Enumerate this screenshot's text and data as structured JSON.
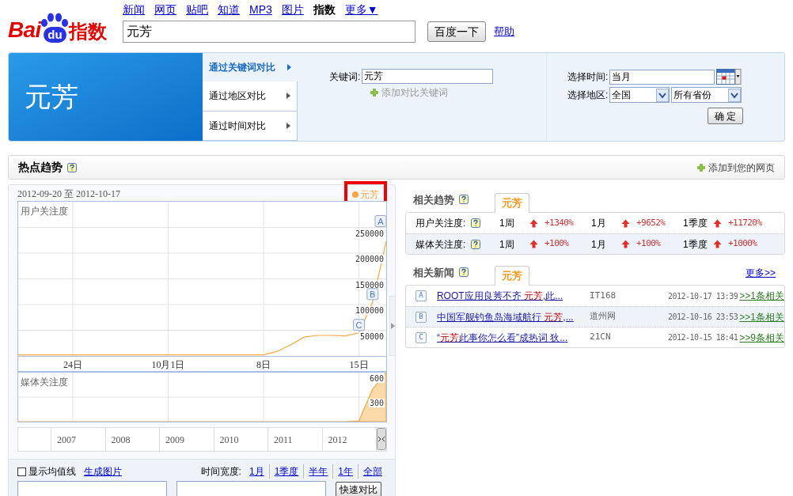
{
  "header": {
    "logo": {
      "text": "Bai",
      "badge": "du",
      "suffix": "指数"
    },
    "nav": [
      {
        "label": "新闻",
        "selected": false
      },
      {
        "label": "网页",
        "selected": false
      },
      {
        "label": "贴吧",
        "selected": false
      },
      {
        "label": "知道",
        "selected": false
      },
      {
        "label": "MP3",
        "selected": false
      },
      {
        "label": "图片",
        "selected": false
      },
      {
        "label": "指数",
        "selected": true
      },
      {
        "label": "更多▼",
        "selected": false
      }
    ],
    "search": {
      "value": "元芳"
    },
    "search_button": "百度一下",
    "help_link": "帮助"
  },
  "keyword_panel": {
    "title": "元芳",
    "compare_tabs": [
      {
        "label": "通过关键词对比",
        "selected": true
      },
      {
        "label": "通过地区对比",
        "selected": false
      },
      {
        "label": "通过时间对比",
        "selected": false
      }
    ],
    "keyword_label": "关键词:",
    "keyword": {
      "value": "元芳"
    },
    "add_keyword": "添加对比关键词",
    "time_label": "选择时间:",
    "time": {
      "value": "当月"
    },
    "region_label": "选择地区:",
    "region": {
      "value": "全国"
    },
    "province": {
      "value": "所有省份"
    },
    "confirm_button": "确 定"
  },
  "hot_trends": {
    "title": "热点趋势",
    "add_to_page": "添加到您的网页",
    "date_range": "2012-09-20 至 2012-10-17",
    "user_chart": {
      "label": "用户关注度",
      "chart_data": {
        "type": "line",
        "categories": [
          null,
          null,
          null,
          null,
          "24日",
          null,
          null,
          null,
          null,
          null,
          null,
          "10月1日",
          null,
          null,
          null,
          null,
          null,
          null,
          "8日",
          null,
          null,
          null,
          null,
          null,
          null,
          "15日",
          null,
          null
        ],
        "series": [
          {
            "name": "元芳",
            "color": "#f5a742",
            "values": [
              2000,
              2000,
              2000,
              2000,
              2000,
              2000,
              2000,
              2000,
              2000,
              2000,
              2000,
              2000,
              2000,
              2000,
              2000,
              2000,
              2000,
              2000,
              2000,
              9000,
              22000,
              37000,
              40000,
              40000,
              39000,
              45000,
              105000,
              223000
            ]
          }
        ],
        "ylim": [
          0,
          300000
        ],
        "grid": true,
        "yticks": [
          {
            "value": 50000,
            "label": "50000"
          },
          {
            "value": 100000,
            "label": "100000"
          },
          {
            "value": 150000,
            "label": "150000"
          },
          {
            "value": 200000,
            "label": "200000"
          },
          {
            "value": 250000,
            "label": "250000"
          }
        ],
        "annotations": [
          "A",
          "B",
          "C"
        ]
      }
    },
    "media_chart": {
      "label": "媒体关注度",
      "chart_data": {
        "type": "area",
        "series": [
          {
            "color": "#f5a742",
            "values": [
              0,
              0,
              0,
              0,
              0,
              0,
              0,
              0,
              0,
              0,
              0,
              0,
              0,
              0,
              0,
              0,
              0,
              0,
              0,
              0,
              0,
              0,
              0,
              0,
              0,
              10,
              400,
              600
            ]
          }
        ],
        "ylim": [
          0,
          600
        ],
        "grid": true,
        "yticks": [
          {
            "value": 300,
            "label": "300"
          },
          {
            "value": 600,
            "label": "600"
          }
        ]
      }
    },
    "years": [
      "2007",
      "2008",
      "2009",
      "2010",
      "2011",
      "2012"
    ],
    "show_average": {
      "label": "显示均值线",
      "checked": false
    },
    "generate_image": "生成图片",
    "span_label": "时间宽度:",
    "spans": [
      "1月",
      "1季度",
      "半年",
      "1年",
      "全部"
    ],
    "compare_button": "快速对比"
  },
  "related_trends": {
    "title": "相关趋势",
    "tab": "元芳",
    "rows": [
      {
        "label": "用户关注度:",
        "stats": [
          {
            "period": "1周",
            "change": "+1340%"
          },
          {
            "period": "1月",
            "change": "+9652%"
          },
          {
            "period": "1季度",
            "change": "+11720%"
          }
        ]
      },
      {
        "label": "媒体关注度:",
        "stats": [
          {
            "period": "1周",
            "change": "+100%"
          },
          {
            "period": "1月",
            "change": "+100%"
          },
          {
            "period": "1季度",
            "change": "+1000%"
          }
        ]
      }
    ]
  },
  "related_news": {
    "title": "相关新闻",
    "tab": "元芳",
    "more_link": "更多>>",
    "items": [
      {
        "letter": "A",
        "title_before": "ROOT应用良莠不齐 ",
        "highlight": "元芳",
        "title_after": ",此...",
        "source": "IT168",
        "time": "2012-10-17 13:39",
        "related": ">>1条相关"
      },
      {
        "letter": "B",
        "title_before": "中国军舰钓鱼岛海域航行 ",
        "highlight": "元芳",
        "title_after": ",...",
        "source": "道州网",
        "time": "2012-10-16 23:53",
        "related": ">>1条相关"
      },
      {
        "letter": "C",
        "title_before": "“",
        "highlight": "元芳",
        "title_after": "此事你怎么看”成热词 狄...",
        "source": "21CN",
        "time": "2012-10-15 18:41",
        "related": ">>9条相关"
      }
    ]
  }
}
